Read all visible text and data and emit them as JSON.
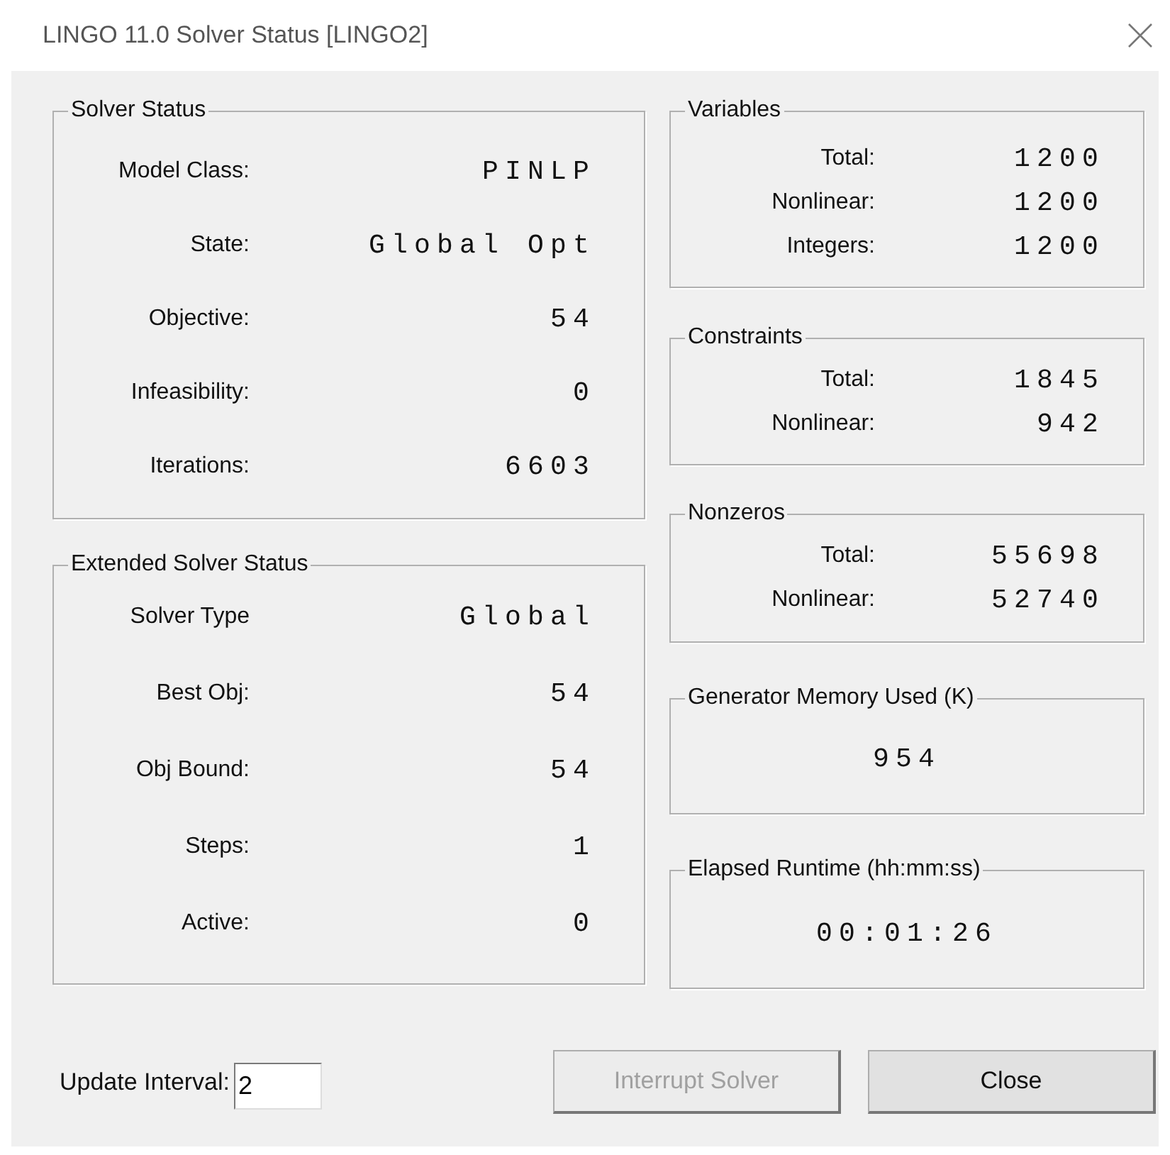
{
  "window": {
    "title": "LINGO 11.0 Solver Status [LINGO2]"
  },
  "left_groups": [
    {
      "title": "Solver Status",
      "kind": "rows",
      "rows": [
        {
          "label": "Model Class:",
          "value": "PINLP"
        },
        {
          "label": "State:",
          "value": "Global Opt"
        },
        {
          "label": "Objective:",
          "value": "54"
        },
        {
          "label": "Infeasibility:",
          "value": "0"
        },
        {
          "label": "Iterations:",
          "value": "6603"
        }
      ]
    },
    {
      "title": "Extended Solver Status",
      "kind": "rows",
      "rows": [
        {
          "label": "Solver Type",
          "value": "Global"
        },
        {
          "label": "Best Obj:",
          "value": "54"
        },
        {
          "label": "Obj Bound:",
          "value": "54"
        },
        {
          "label": "Steps:",
          "value": "1"
        },
        {
          "label": "Active:",
          "value": "0"
        }
      ]
    }
  ],
  "right_groups": [
    {
      "title": "Variables",
      "kind": "rows",
      "rows": [
        {
          "label": "Total:",
          "value": "1200"
        },
        {
          "label": "Nonlinear:",
          "value": "1200"
        },
        {
          "label": "Integers:",
          "value": "1200"
        }
      ]
    },
    {
      "title": "Constraints",
      "kind": "rows",
      "rows": [
        {
          "label": "Total:",
          "value": "1845"
        },
        {
          "label": "Nonlinear:",
          "value": "942"
        }
      ]
    },
    {
      "title": "Nonzeros",
      "kind": "rows",
      "rows": [
        {
          "label": "Total:",
          "value": "55698"
        },
        {
          "label": "Nonlinear:",
          "value": "52740"
        }
      ]
    },
    {
      "title": "Generator Memory Used (K)",
      "kind": "single",
      "value": "954"
    },
    {
      "title": "Elapsed Runtime (hh:mm:ss)",
      "kind": "single",
      "value": "00:01:26"
    }
  ],
  "update_interval": {
    "label": "Update Interval:",
    "value": "2"
  },
  "buttons": [
    {
      "label": "Interrupt Solver",
      "disabled": true
    },
    {
      "label": "Close",
      "disabled": false
    }
  ]
}
